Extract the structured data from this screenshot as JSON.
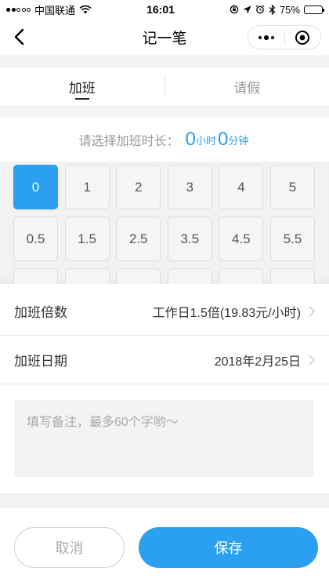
{
  "status_bar": {
    "carrier": "中国联通",
    "time": "16:01",
    "battery": "75%"
  },
  "nav": {
    "title": "记一笔"
  },
  "tabs": [
    {
      "label": "加班",
      "active": true
    },
    {
      "label": "请假",
      "active": false
    }
  ],
  "duration": {
    "label": "请选择加班时长：",
    "hours": "0",
    "hours_unit": "小时",
    "minutes": "0",
    "minutes_unit": "分钟",
    "options": [
      "0",
      "1",
      "2",
      "3",
      "4",
      "5",
      "0.5",
      "1.5",
      "2.5",
      "3.5",
      "4.5",
      "5.5",
      "",
      "",
      "",
      "",
      "",
      ""
    ],
    "selected": "0"
  },
  "multiplier": {
    "label": "加班倍数",
    "value": "工作日1.5倍(19.83元/小时)"
  },
  "date": {
    "label": "加班日期",
    "value": "2018年2月25日"
  },
  "note": {
    "placeholder": "填写备注，最多60个字哟～"
  },
  "buttons": {
    "cancel": "取消",
    "save": "保存"
  },
  "colors": {
    "accent": "#2b9ff0"
  }
}
